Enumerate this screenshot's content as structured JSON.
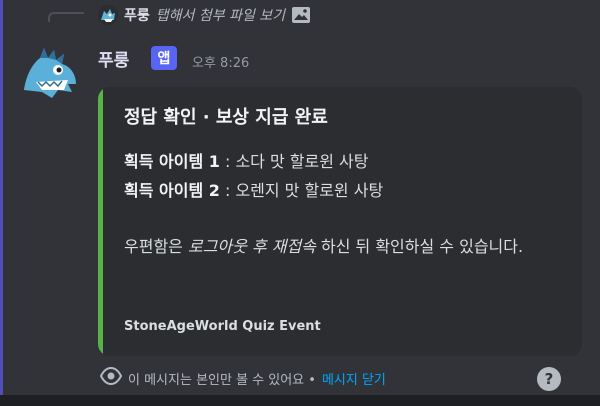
{
  "reply": {
    "name": "푸룽",
    "text": "탭해서 첨부 파일 보기"
  },
  "message": {
    "username": "푸룽",
    "badge": "앱",
    "timestamp": "오후 8:26"
  },
  "embed": {
    "accent_color": "#57b348",
    "title": "정답 확인 · 보상 지급 완료",
    "items": [
      {
        "label": "획득 아이템 1",
        "sep": " : ",
        "value": "소다 맛 할로윈 사탕"
      },
      {
        "label": "획득 아이템 2",
        "sep": " : ",
        "value": "오렌지 맛 할로윈 사탕"
      }
    ],
    "mail_note_pre": "우편함은 ",
    "mail_note_em": "로그아웃 후 재접속",
    "mail_note_post": " 하신 뒤 확인하실 수 있습니다.",
    "footer": "StoneAgeWorld Quiz Event"
  },
  "ephemeral": {
    "text": "이 메시지는 본인만 볼 수 있어요 • ",
    "dismiss": "메시지 닫기",
    "help": "?"
  },
  "colors": {
    "background": "#313338",
    "embed_bg": "#2b2d31",
    "link": "#00a8fc",
    "badge": "#5865f2"
  }
}
